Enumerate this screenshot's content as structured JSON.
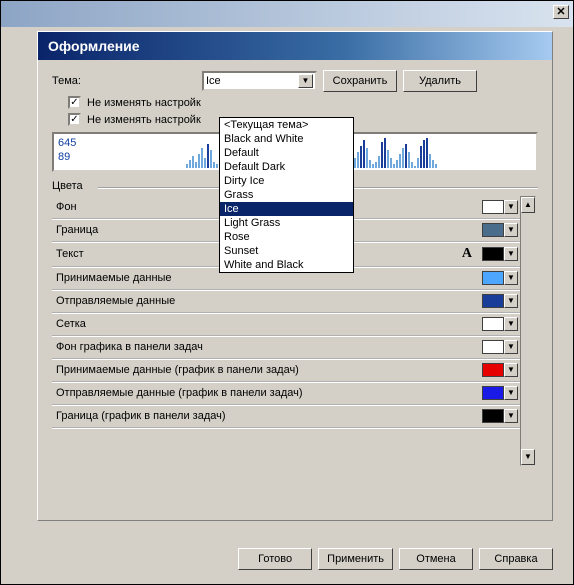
{
  "window": {
    "title": "Оформление"
  },
  "theme": {
    "label": "Тема:",
    "value": "Ice",
    "save": "Сохранить",
    "delete": "Удалить",
    "options": [
      "<Текущая тема>",
      "Black and White",
      "Default",
      "Default Dark",
      "Dirty Ice",
      "Grass",
      "Ice",
      "Light Grass",
      "Rose",
      "Sunset",
      "White and Black"
    ],
    "selected_index": 6
  },
  "checks": {
    "c1": "Не изменять настройк",
    "c2": "Не изменять настройк"
  },
  "graph": {
    "v1": "645",
    "v2": "89"
  },
  "section_colors": "Цвета",
  "colors": [
    {
      "label": "Фон",
      "hex": "#ffffff"
    },
    {
      "label": "Граница",
      "hex": "#4a6d8c"
    },
    {
      "label": "Текст",
      "hex": "#000000",
      "hasA": true
    },
    {
      "label": "Принимаемые данные",
      "hex": "#4da6ff"
    },
    {
      "label": "Отправляемые данные",
      "hex": "#1a3d99"
    },
    {
      "label": "Сетка",
      "hex": "#ffffff"
    },
    {
      "label": "Фон графика в панели задач",
      "hex": "#ffffff"
    },
    {
      "label": "Принимаемые данные (график в панели задач)",
      "hex": "#e60000"
    },
    {
      "label": "Отправляемые данные (график в панели задач)",
      "hex": "#1a1ae6"
    },
    {
      "label": "Граница (график в панели задач)",
      "hex": "#000000"
    }
  ],
  "buttons": {
    "ok": "Готово",
    "apply": "Применить",
    "cancel": "Отмена",
    "help": "Справка"
  }
}
